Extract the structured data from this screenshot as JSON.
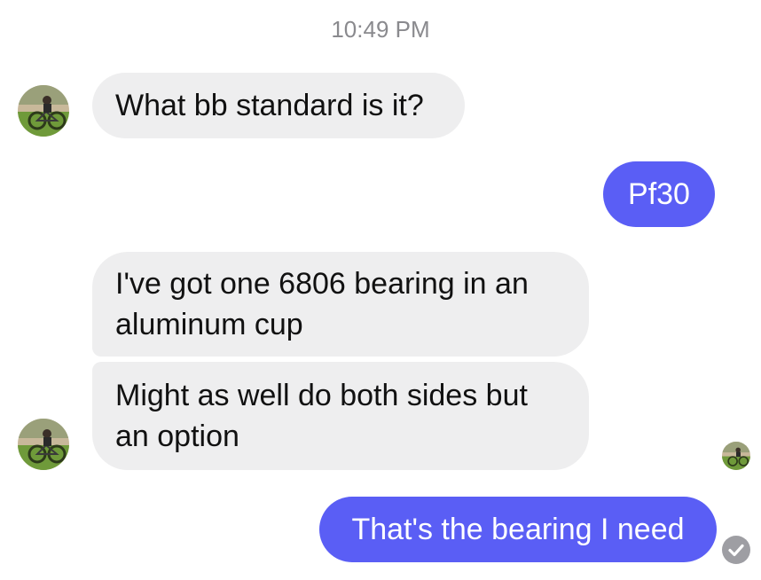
{
  "conversation": {
    "timestamp": "10:49 PM",
    "messages": [
      {
        "sender": "contact",
        "text": "What bb standard is it?"
      },
      {
        "sender": "me",
        "text": "Pf30"
      },
      {
        "sender": "contact",
        "text": "I've got one 6806 bearing in an aluminum cup"
      },
      {
        "sender": "contact",
        "text": "Might as well do both sides but an option"
      },
      {
        "sender": "me",
        "text": "That's the bearing I need"
      }
    ]
  },
  "colors": {
    "incoming_bubble": "#eeeeef",
    "outgoing_bubble": "#5a5ef5",
    "timestamp_text": "#8a8a8e",
    "delivered_check": "#9e9ea3"
  },
  "icons": {
    "contact_avatar": "contact-avatar-photo",
    "read_receipt": "seen-avatar-icon",
    "delivered": "checkmark-circle-icon"
  }
}
